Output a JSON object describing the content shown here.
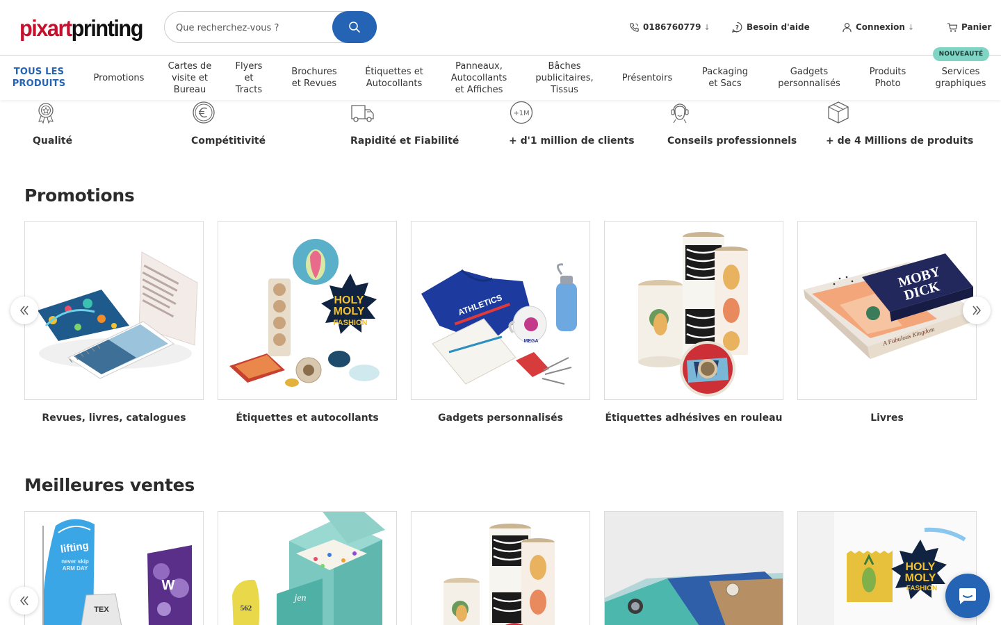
{
  "header": {
    "logo_part1": "pixart",
    "logo_part2": "printing",
    "search_placeholder": "Que recherchez-vous ?",
    "phone": "0186760779",
    "help": "Besoin d'aide",
    "login": "Connexion",
    "cart": "Panier",
    "dropdown_arrow": "↓"
  },
  "nav": {
    "all_products": "TOUS LES PRODUITS",
    "items": [
      "Promotions",
      "Cartes de visite et Bureau",
      "Flyers et Tracts",
      "Brochures et Revues",
      "Étiquettes et Autocollants",
      "Panneaux, Autocollants et Affiches",
      "Bâches publicitaires, Tissus",
      "Présentoirs",
      "Packaging et Sacs",
      "Gadgets personnalisés",
      "Produits Photo",
      "Services graphiques"
    ],
    "badge": "NOUVEAUTÉ"
  },
  "features": [
    {
      "label": "Qualité",
      "icon": "award-icon"
    },
    {
      "label": "Compétitivité",
      "icon": "euro-icon"
    },
    {
      "label": "Rapidité et Fiabilité",
      "icon": "truck-icon"
    },
    {
      "label": "+ d'1 million de clients",
      "icon": "million-icon",
      "icon_text": "+1M"
    },
    {
      "label": "Conseils professionnels",
      "icon": "support-agent-icon"
    },
    {
      "label": "+ de 4 Millions de produits",
      "icon": "box-icon"
    }
  ],
  "promotions": {
    "title": "Promotions",
    "cards": [
      {
        "title": "Revues, livres, catalogues"
      },
      {
        "title": "Étiquettes et autocollants"
      },
      {
        "title": "Gadgets personnalisés"
      },
      {
        "title": "Étiquettes adhésives en rouleau"
      },
      {
        "title": "Livres"
      }
    ]
  },
  "bestsellers": {
    "title": "Meilleures ventes"
  },
  "colors": {
    "brand_red": "#c7102e",
    "accent_blue": "#2563b5",
    "badge_teal": "#7fd4c3"
  }
}
